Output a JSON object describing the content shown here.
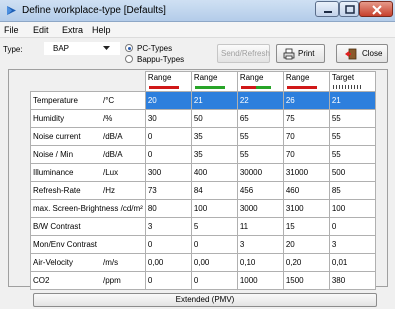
{
  "window": {
    "title": "Define workplace-type  [Defaults]"
  },
  "menu": [
    "File",
    "Edit",
    "Extra",
    "Help"
  ],
  "toolbar": {
    "type_label": "Type:",
    "type_value": "BAP",
    "radio_pc": "PC-Types",
    "radio_bappu": "Bappu-Types",
    "send_refresh": "Send/Refresh",
    "print": "Print",
    "close": "Close"
  },
  "table": {
    "headers": [
      "Range",
      "Range",
      "Range",
      "Range",
      "Target"
    ],
    "header_swatches": [
      "red",
      "green",
      "mix",
      "red",
      "target"
    ],
    "rows": [
      {
        "name": "Temperature",
        "unit": "/°C",
        "values": [
          "20",
          "21",
          "22",
          "26",
          "21"
        ],
        "selected": true
      },
      {
        "name": "Humidity",
        "unit": "/%",
        "values": [
          "30",
          "50",
          "65",
          "75",
          "55"
        ]
      },
      {
        "name": "Noise current",
        "unit": "/dB/A",
        "values": [
          "0",
          "35",
          "55",
          "70",
          "55"
        ]
      },
      {
        "name": "Noise / Min",
        "unit": "/dB/A",
        "values": [
          "0",
          "35",
          "55",
          "70",
          "55"
        ]
      },
      {
        "name": "Illuminance",
        "unit": "/Lux",
        "values": [
          "300",
          "400",
          "30000",
          "31000",
          "500"
        ]
      },
      {
        "name": "Refresh-Rate",
        "unit": "/Hz",
        "values": [
          "73",
          "84",
          "456",
          "460",
          "85"
        ]
      },
      {
        "name": "max. Screen-Brightness /cd/m²",
        "unit": "",
        "values": [
          "80",
          "100",
          "3000",
          "3100",
          "100"
        ]
      },
      {
        "name": "B/W Contrast",
        "unit": "",
        "values": [
          "3",
          "5",
          "11",
          "15",
          "0"
        ]
      },
      {
        "name": "Mon/Env Contrast",
        "unit": "",
        "values": [
          "0",
          "0",
          "3",
          "20",
          "3"
        ]
      },
      {
        "name": "Air-Velocity",
        "unit": "/m/s",
        "values": [
          "0,00",
          "0,00",
          "0,10",
          "0,20",
          "0,01"
        ]
      },
      {
        "name": "CO2",
        "unit": "/ppm",
        "values": [
          "0",
          "0",
          "1000",
          "1500",
          "380"
        ]
      }
    ]
  },
  "extended_button": "Extended (PMV)",
  "colors": {
    "selection": "#2d7fdd",
    "range_red": "#d01818",
    "range_green": "#28a428"
  }
}
